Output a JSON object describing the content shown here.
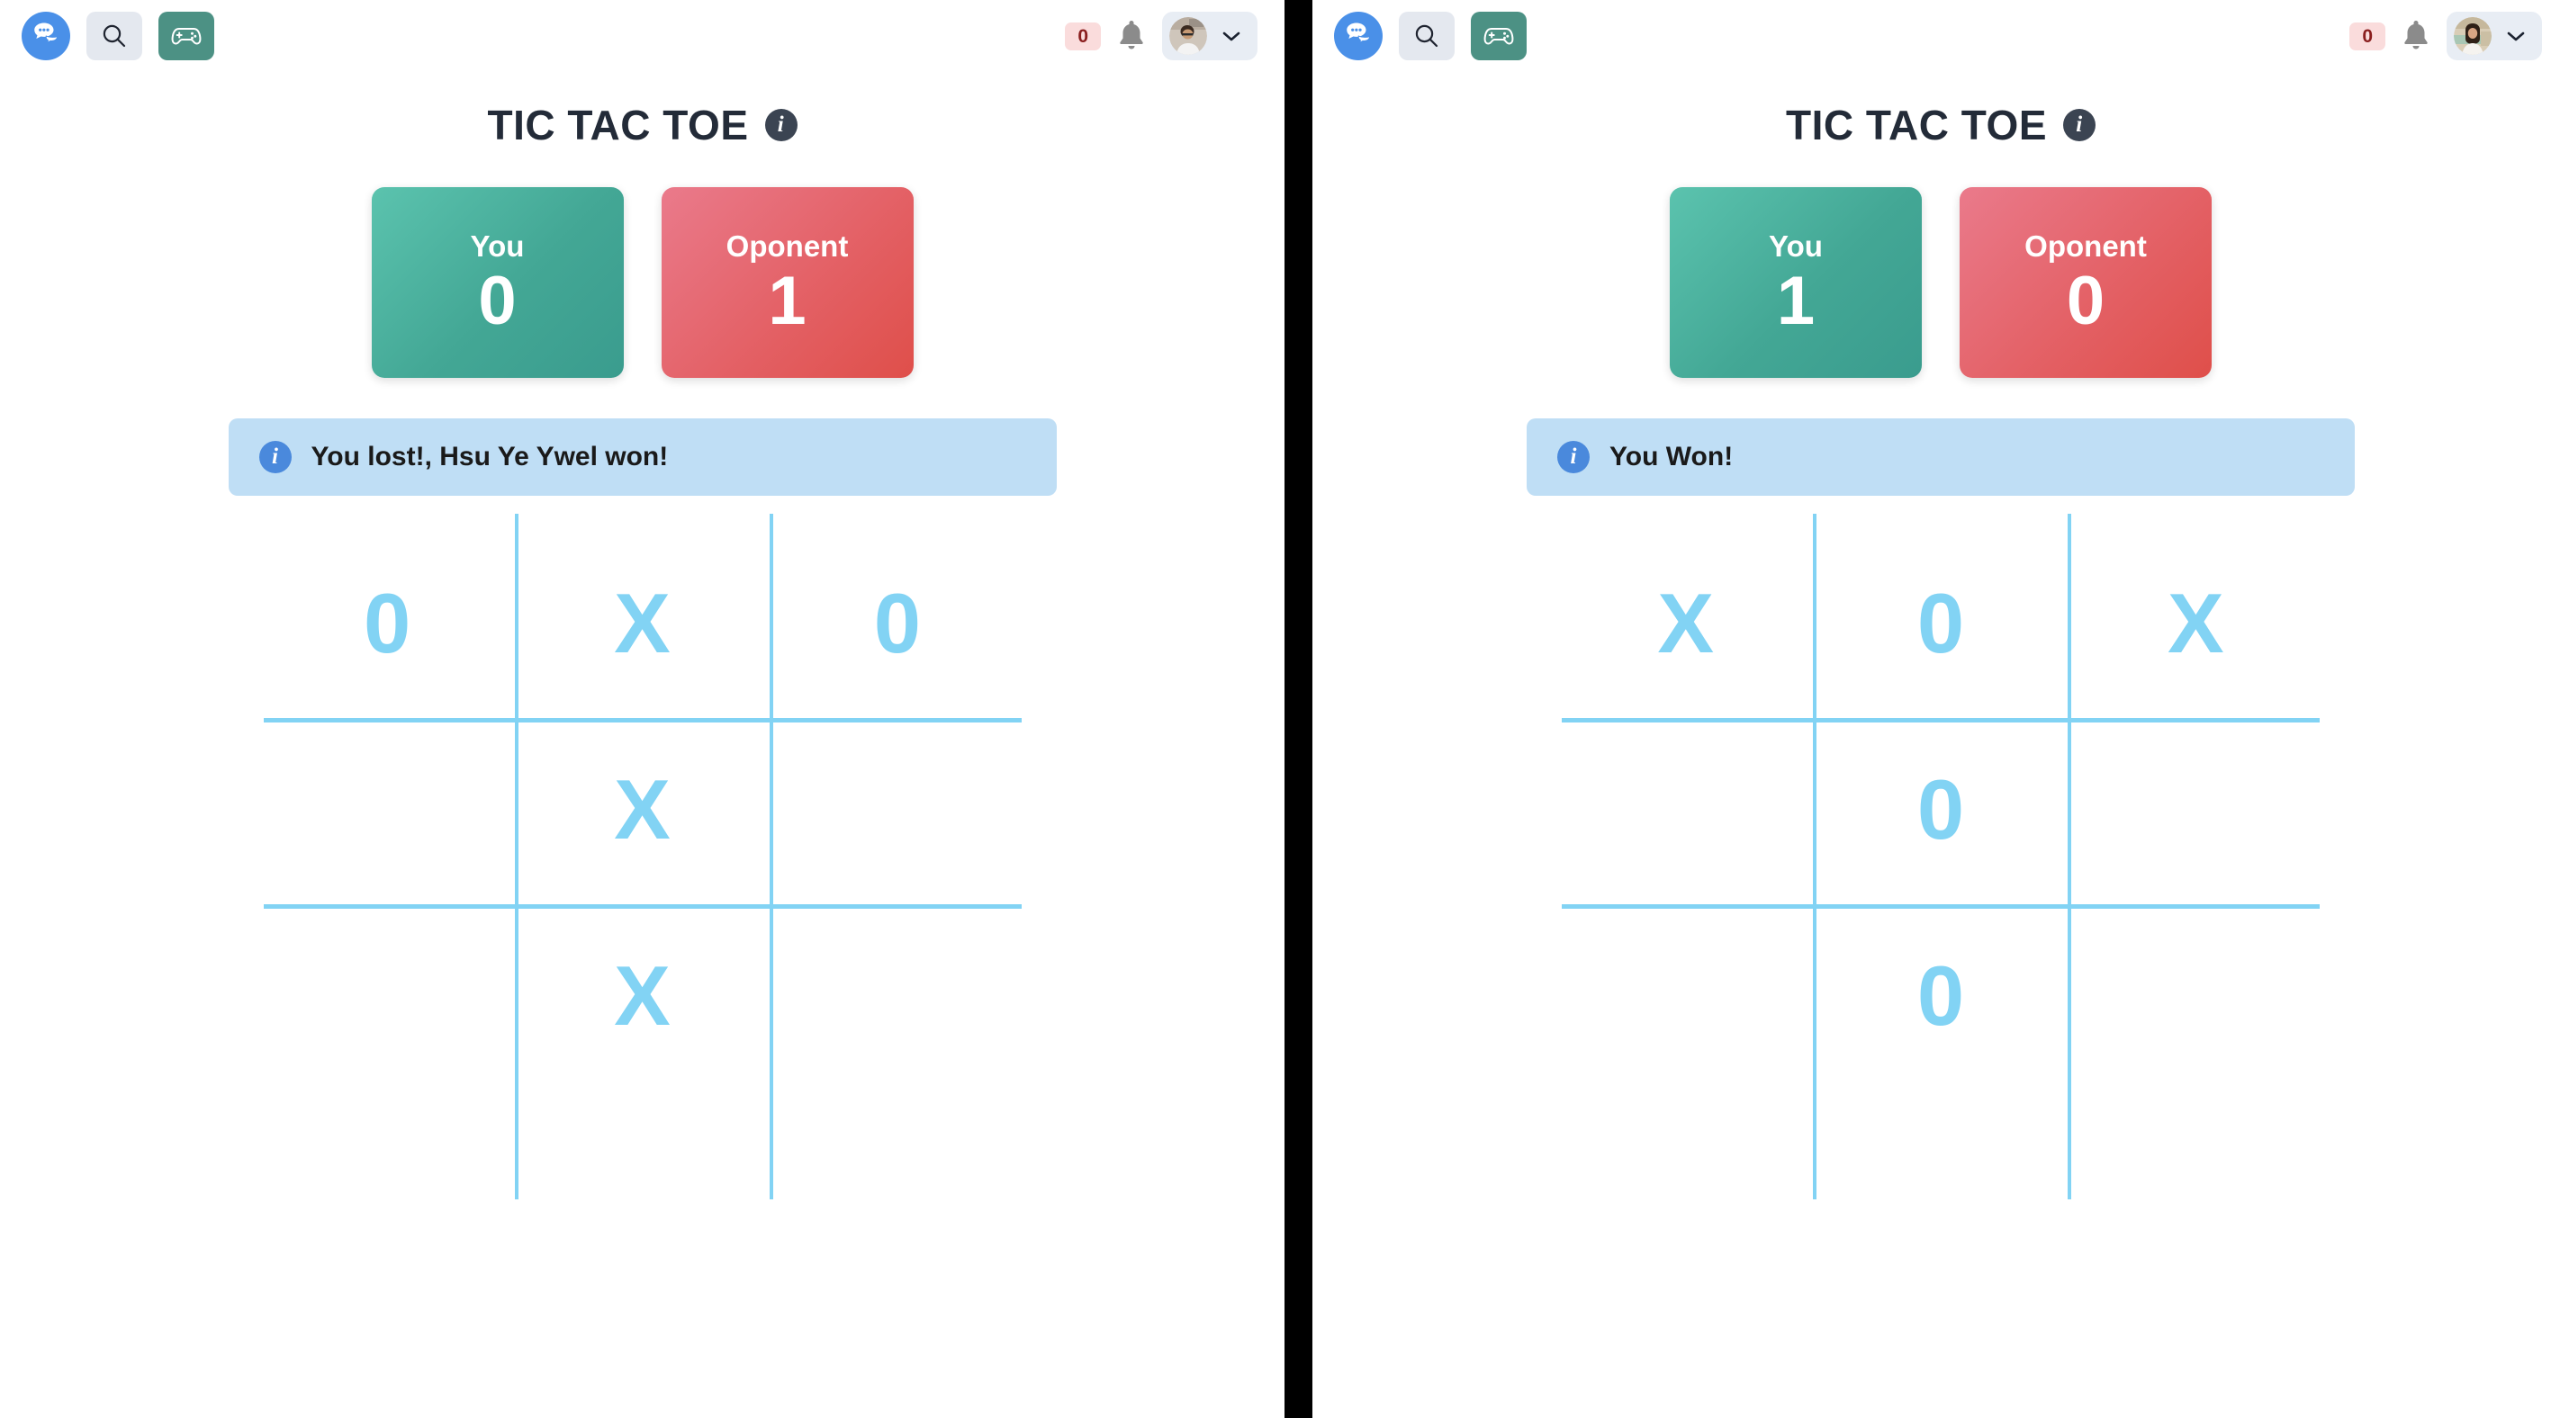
{
  "panels": [
    {
      "id": "left",
      "topbar": {
        "logo_icon": "chat-bubbles-icon",
        "search_icon": "search-icon",
        "game_icon": "gamepad-icon",
        "notification_count": "0",
        "bell_icon": "bell-icon",
        "avatar_icon": "user-avatar-male",
        "chevron_icon": "chevron-down-icon"
      },
      "game": {
        "title": "TIC TAC TOE",
        "info_icon": "info-icon",
        "you_label": "You",
        "you_score": "0",
        "opponent_label": "Oponent",
        "opponent_score": "1",
        "alert_icon": "info-icon",
        "alert_text": "You lost!, Hsu Ye Ywel won!",
        "board": [
          "0",
          "X",
          "0",
          "",
          "X",
          "",
          "",
          "X",
          ""
        ]
      }
    },
    {
      "id": "right",
      "topbar": {
        "logo_icon": "chat-bubbles-icon",
        "search_icon": "search-icon",
        "game_icon": "gamepad-icon",
        "notification_count": "0",
        "bell_icon": "bell-icon",
        "avatar_icon": "user-avatar-female",
        "chevron_icon": "chevron-down-icon"
      },
      "game": {
        "title": "TIC TAC TOE",
        "info_icon": "info-icon",
        "you_label": "You",
        "you_score": "1",
        "opponent_label": "Oponent",
        "opponent_score": "0",
        "alert_icon": "info-icon",
        "alert_text": "You Won!",
        "board": [
          "X",
          "0",
          "X",
          "",
          "0",
          "",
          "",
          "0",
          ""
        ]
      }
    }
  ],
  "colors": {
    "logo_blue": "#4a90e8",
    "game_green": "#4c9184",
    "search_gray": "#e4e8ef",
    "badge_bg": "#fadcdc",
    "badge_text": "#8a1f1f",
    "title_dark": "#232b38",
    "you_gradient_start": "#5bc3ae",
    "you_gradient_end": "#3a9c8e",
    "opp_gradient_start": "#ea7a8b",
    "opp_gradient_end": "#df4f4a",
    "alert_bg": "#bfdef5",
    "alert_icon_bg": "#4a89dc",
    "board_line": "#82d3f4",
    "mark_color": "#82d3f4",
    "divider": "#000000"
  }
}
